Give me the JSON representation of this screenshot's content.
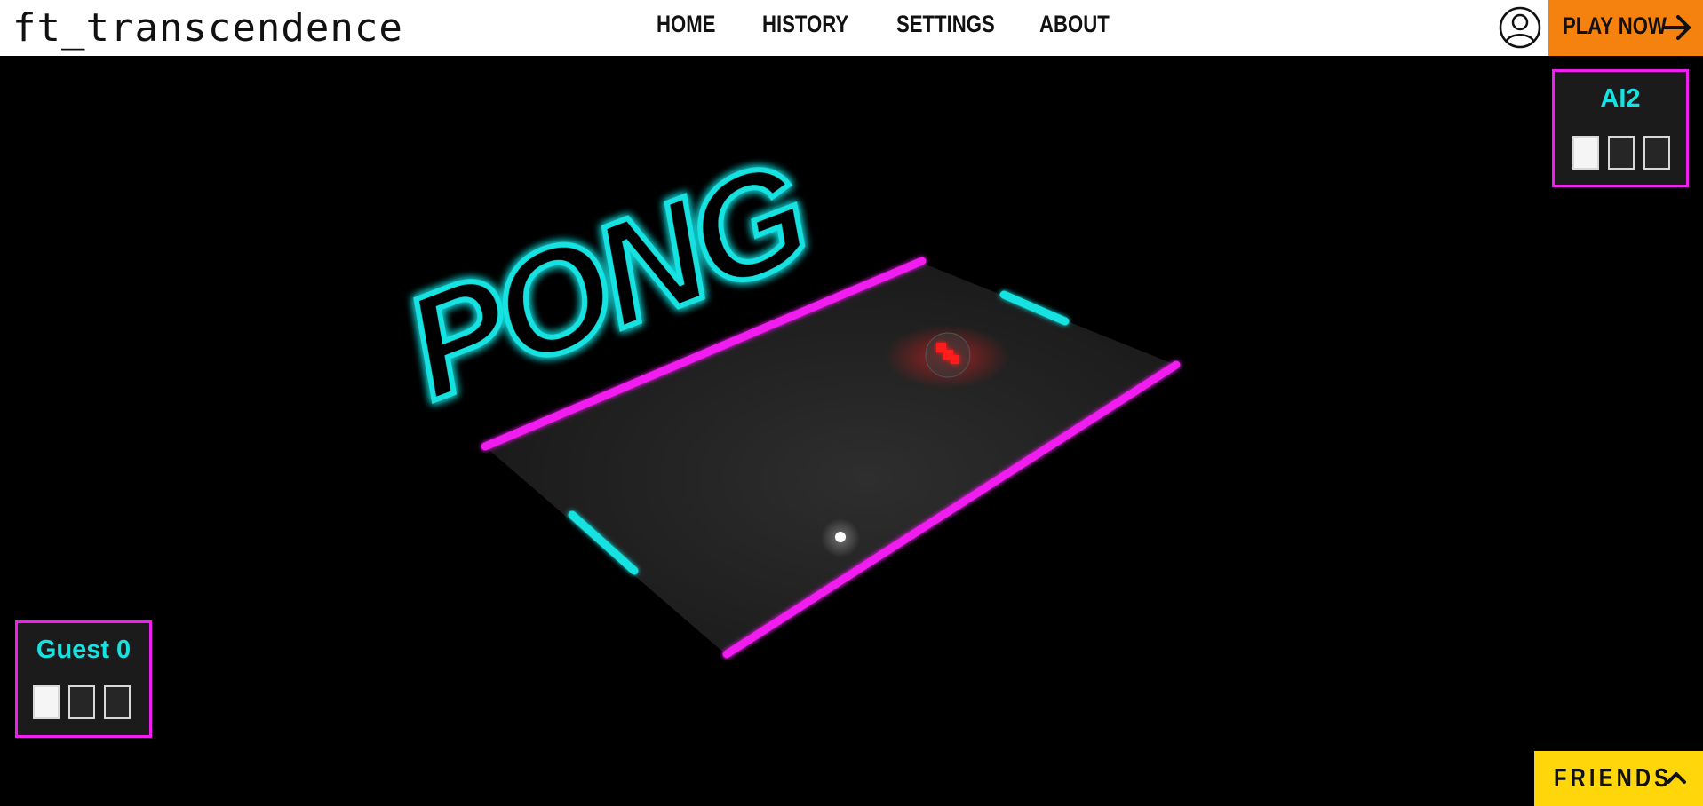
{
  "app": {
    "title": "ft_transcendence"
  },
  "nav": {
    "items": [
      {
        "label": "HOME"
      },
      {
        "label": "HISTORY"
      },
      {
        "label": "SETTINGS"
      },
      {
        "label": "ABOUT"
      }
    ],
    "account_icon": "user-circle-icon",
    "play_button": {
      "label": "PLAY NOW",
      "icon": "arrow-right-icon"
    }
  },
  "game": {
    "logo_text": "PONG",
    "player_top": {
      "name": "AI2",
      "lives_total": 3,
      "lives_filled": 1
    },
    "player_bottom": {
      "name": "Guest 0",
      "lives_total": 3,
      "lives_filled": 1
    }
  },
  "friends": {
    "label": "FRIENDS",
    "icon": "chevron-up-icon"
  },
  "colors": {
    "accent_orange": "#f5820f",
    "accent_yellow": "#ffd60a",
    "neon_magenta": "#f01ef0",
    "neon_cyan": "#16e2e2",
    "ball_red": "#ff1a1a"
  }
}
